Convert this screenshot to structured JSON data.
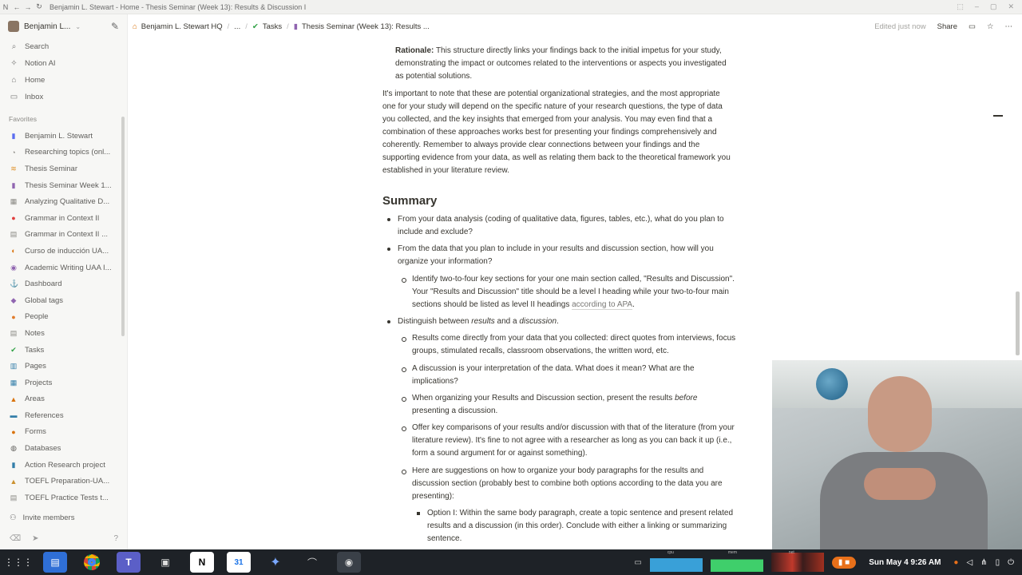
{
  "window": {
    "title": "Benjamin L. Stewart - Home - Thesis Seminar (Week 13): Results & Discussion I"
  },
  "sidebar": {
    "workspace": "Benjamin L...",
    "nav": [
      {
        "label": "Search",
        "icon": "search-icon"
      },
      {
        "label": "Notion AI",
        "icon": "ai-icon"
      },
      {
        "label": "Home",
        "icon": "home-icon"
      },
      {
        "label": "Inbox",
        "icon": "inbox-icon"
      }
    ],
    "favorites_label": "Favorites",
    "favorites": [
      {
        "label": "Benjamin L. Stewart",
        "icon": "▮",
        "color": "#5b6ef0"
      },
      {
        "label": "Researching topics (onl...",
        "icon": "◔",
        "color": "#8a8984"
      },
      {
        "label": "Thesis Seminar",
        "icon": "≋",
        "color": "#e0932b"
      },
      {
        "label": "Thesis Seminar Week 1...",
        "icon": "▮",
        "color": "#9065b0"
      },
      {
        "label": "Analyzing Qualitative D...",
        "icon": "▦",
        "color": "#8a8984"
      },
      {
        "label": "Grammar in Context II",
        "icon": "●",
        "color": "#e03e3e"
      },
      {
        "label": "Grammar in Context II ...",
        "icon": "▤",
        "color": "#8a8984"
      },
      {
        "label": "Curso de inducción UA...",
        "icon": "◐",
        "color": "#d9730d"
      },
      {
        "label": "Academic Writing UAA I...",
        "icon": "◉",
        "color": "#9065b0"
      },
      {
        "label": "Dashboard",
        "icon": "⚓",
        "color": "#cb912f"
      },
      {
        "label": "Global tags",
        "icon": "◆",
        "color": "#9065b0"
      },
      {
        "label": "People",
        "icon": "●",
        "color": "#e07b2b"
      },
      {
        "label": "Notes",
        "icon": "▤",
        "color": "#8a8984"
      },
      {
        "label": "Tasks",
        "icon": "✔",
        "color": "#2ea043"
      },
      {
        "label": "Pages",
        "icon": "▥",
        "color": "#337ea9"
      },
      {
        "label": "Projects",
        "icon": "▦",
        "color": "#337ea9"
      },
      {
        "label": "Areas",
        "icon": "▲",
        "color": "#d9730d"
      },
      {
        "label": "References",
        "icon": "▬",
        "color": "#337ea9"
      },
      {
        "label": "Forms",
        "icon": "●",
        "color": "#d9730d"
      },
      {
        "label": "Databases",
        "icon": "◍",
        "color": "#5f5e5b"
      },
      {
        "label": "Action Research project",
        "icon": "▮",
        "color": "#337ea9"
      },
      {
        "label": "TOEFL Preparation-UA...",
        "icon": "▲",
        "color": "#cb912f"
      },
      {
        "label": "TOEFL Practice Tests t...",
        "icon": "▤",
        "color": "#8a8984"
      }
    ],
    "invite_label": "Invite members"
  },
  "topbar": {
    "breadcrumbs": [
      "Benjamin L. Stewart HQ",
      "...",
      "Tasks",
      "Thesis Seminar (Week 13): Results ..."
    ],
    "edited": "Edited just now",
    "share": "Share"
  },
  "doc": {
    "rationale_label": "Rationale:",
    "rationale_lines": [
      "This structure directly links your findings back to the initial impetus for your study,",
      "demonstrating the impact or outcomes related to the interventions or aspects you investigated",
      "as potential solutions."
    ],
    "para_lines": [
      "It's important to note that these are potential organizational strategies, and the most appropriate",
      "one for your study will depend on the specific nature of your research questions, the type of data",
      "you collected, and the key insights that emerged from your analysis. You may even find that a",
      "combination of these approaches works best for presenting your findings comprehensively and",
      "coherently. Remember to always provide clear connections between your findings and the",
      "supporting evidence from your data, as well as relating them back to the theoretical framework you",
      "established in your literature review."
    ],
    "summary_heading": "Summary",
    "b1_a": [
      "From your data analysis (coding of qualitative data, figures, tables, etc.), what do you plan to",
      "include and exclude?"
    ],
    "b1_b": [
      "From the data that you plan to include in your results and discussion section, how will you",
      "organize your information?"
    ],
    "b2_a": [
      "Identify two-to-four key sections for your one main section called, \"Results and Discussion\".",
      "Your \"Results and Discussion\" title should be a level I heading while your two-to-four main",
      "sections should be listed as level II headings"
    ],
    "b2_a_link": "according to APA",
    "b1_c_pre": "Distinguish between ",
    "b1_c_i1": "results",
    "b1_c_mid": " and a ",
    "b1_c_i2": "discussion",
    "b1_c_post": ".",
    "b2_b": [
      "Results come directly from your data that you collected: direct quotes from interviews, focus",
      "groups, stimulated recalls, classroom observations, the written word, etc."
    ],
    "b2_c": [
      "A discussion is your interpretation of the data. What does it mean? What are the",
      "implications?"
    ],
    "b2_d_pre": "When organizing your Results and Discussion section, present the results ",
    "b2_d_i": "before",
    "b2_d_line2": "presenting a discussion.",
    "b2_e": [
      "Offer key comparisons of your results and/or discussion with that of the literature (from your",
      "literature review). It's fine to not agree with a researcher as long as you can back it up (i.e.,",
      "form a sound argument for or against something)."
    ],
    "b2_f": [
      "Here are suggestions on how to organize your body paragraphs for the results and",
      "discussion section (probably best to combine both options according to the data you are",
      "presenting):"
    ],
    "b3_a": [
      "Option I: Within the same body paragraph, create a topic sentence and present related",
      "results and a discussion (in this order). Conclude with either a linking or summarizing",
      "sentence."
    ]
  },
  "taskbar": {
    "apps": [
      "apps-grid-icon",
      "files-icon",
      "chrome-icon",
      "teams-icon",
      "package-icon",
      "notion-icon",
      "calendar-icon",
      "gemini-icon",
      "audio-icon",
      "obs-icon"
    ],
    "graph_labels": [
      "cpu",
      "mem",
      "net"
    ],
    "clock": "Sun May 4  9:26 AM"
  }
}
